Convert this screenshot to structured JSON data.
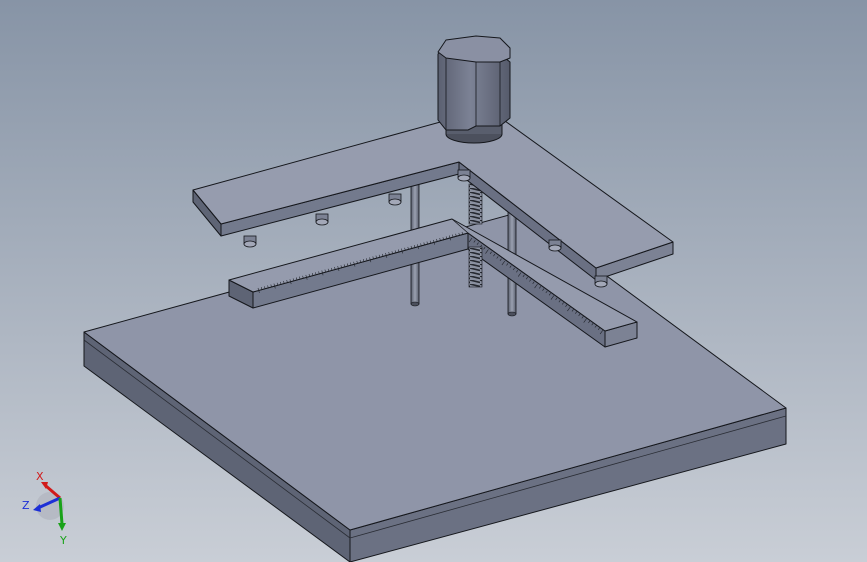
{
  "viewport": {
    "background_top": "#8794a6",
    "background_bottom": "#c9ced6"
  },
  "model": {
    "colors": {
      "face_top": "#8f95a8",
      "face_top_light": "#9ea3b4",
      "face_side_dark": "#5e6475",
      "face_side_mid": "#737a8d",
      "edge": "#15171c",
      "shadow_line": "#b8bcc8",
      "spring": "#3b3f4a",
      "rod": "#7c8293"
    }
  },
  "triad": {
    "x_label": "X",
    "y_label": "Y",
    "z_label": "Z",
    "x_color": "#d11a1a",
    "y_color": "#19a219",
    "z_color": "#1c2fd6"
  }
}
